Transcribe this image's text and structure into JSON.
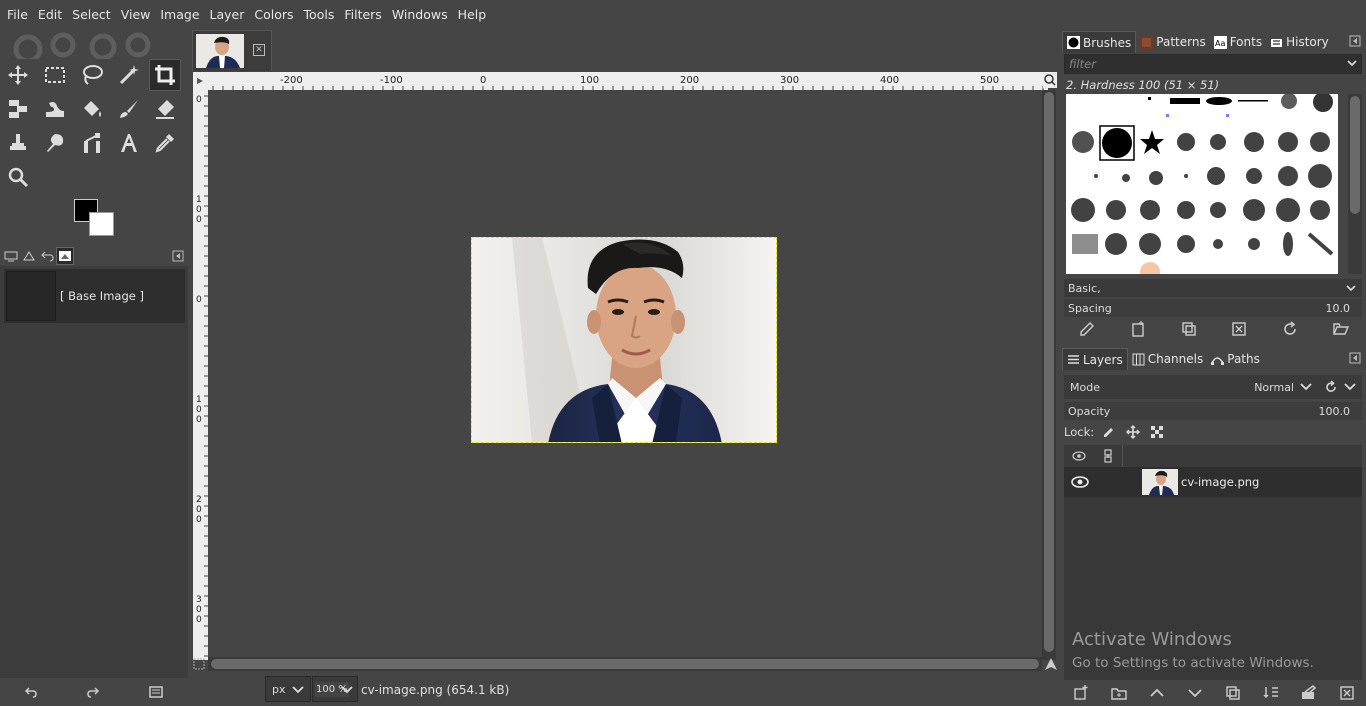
{
  "menubar": {
    "items": [
      "File",
      "Edit",
      "Select",
      "View",
      "Image",
      "Layer",
      "Colors",
      "Tools",
      "Filters",
      "Windows",
      "Help"
    ]
  },
  "toolbox": {
    "tools": [
      "move-tool",
      "rect-select-tool",
      "free-select-tool",
      "fuzzy-select-tool",
      "crop-tool",
      "unified-transform-tool",
      "warp-tool",
      "bucket-fill-tool",
      "paintbrush-tool",
      "eraser-tool",
      "clone-tool",
      "smudge-tool",
      "paths-tool",
      "text-tool",
      "color-picker-tool",
      "zoom-tool"
    ],
    "active_tool": "crop-tool",
    "fg_color": "#000000",
    "bg_color": "#ffffff"
  },
  "images_dock": {
    "item_label": "[ Base Image ]"
  },
  "canvas": {
    "ruler_h_labels": [
      "-200",
      "-100",
      "0",
      "100",
      "200",
      "300",
      "400",
      "500"
    ],
    "ruler_v_labels": [
      "0",
      "100",
      "0",
      "100",
      "200",
      "300"
    ],
    "unit": "px",
    "zoom": "100 %",
    "status": "cv-image.png (654.1 kB)"
  },
  "brushes_dock": {
    "tabs": [
      "Brushes",
      "Patterns",
      "Fonts",
      "History"
    ],
    "filter_placeholder": "filter",
    "brush_name": "2. Hardness 100 (51 × 51)",
    "preset": "Basic,",
    "spacing_label": "Spacing",
    "spacing_value": "10.0"
  },
  "layers_dock": {
    "tabs": [
      "Layers",
      "Channels",
      "Paths"
    ],
    "mode_label": "Mode",
    "mode_value": "Normal",
    "opacity_label": "Opacity",
    "opacity_value": "100.0",
    "lock_label": "Lock:",
    "layer_name": "cv-image.png"
  },
  "watermark": {
    "line1": "Activate Windows",
    "line2": "Go to Settings to activate Windows."
  }
}
